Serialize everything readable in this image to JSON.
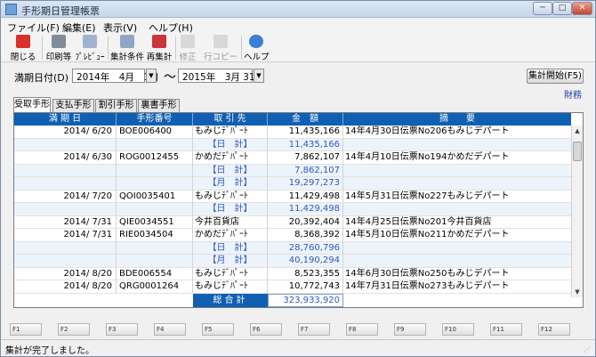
{
  "window": {
    "title": "手形期日管理帳票",
    "minimize": "─",
    "maximize": "□",
    "close": "✕"
  },
  "menu": [
    "ファイル(F)",
    "編集(E)",
    "表示(V)",
    "ヘルプ(H)"
  ],
  "toolbar": {
    "close": "閉じる",
    "print": "印刷等",
    "preview": "ﾌﾟﾚﾋﾞｭｰ",
    "agg_condition": "集計条件",
    "reaggregate": "再集計",
    "modify": "修正",
    "row_copy": "行コピー",
    "help": "ヘルプ"
  },
  "date_range": {
    "label": "満期日付(D)",
    "from": "2014年　4月　1日",
    "tilde": "～",
    "to": "2015年　3月 31日"
  },
  "agg_start_button": "集計開始(F5)",
  "zaimu_link": "財務",
  "tabs": [
    "受取手形",
    "支払手形",
    "割引手形",
    "裏書手形"
  ],
  "table": {
    "headers": [
      "満 期 日",
      "手形番号",
      "取 引 先",
      "金　額",
      "摘　　要"
    ],
    "rows": [
      {
        "date": "2014/ 6/20",
        "num": "BOE006400",
        "name": "もみじﾃﾞﾊﾟｰﾄ",
        "amount": "11,435,166",
        "desc": "14年4月30日伝票No206もみじデパート",
        "type": "data"
      },
      {
        "label": "【日　計】",
        "amount": "11,435,166",
        "type": "sub"
      },
      {
        "date": "2014/ 6/30",
        "num": "ROG0012455",
        "name": "かめだﾃﾞﾊﾟｰﾄ",
        "amount": "7,862,107",
        "desc": "14年4月10日伝票No194かめだデパート",
        "type": "data"
      },
      {
        "label": "【日　計】",
        "amount": "7,862,107",
        "type": "sub"
      },
      {
        "label": "【月　計】",
        "amount": "19,297,273",
        "type": "sub"
      },
      {
        "date": "2014/ 7/20",
        "num": "QOI0035401",
        "name": "もみじﾃﾞﾊﾟｰﾄ",
        "amount": "11,429,498",
        "desc": "14年5月31日伝票No227もみじデパート",
        "type": "data"
      },
      {
        "label": "【日　計】",
        "amount": "11,429,498",
        "type": "sub"
      },
      {
        "date": "2014/ 7/31",
        "num": "QIE0034551",
        "name": "今井百貨店",
        "amount": "20,392,404",
        "desc": "14年4月25日伝票No201今井百貨店",
        "type": "data"
      },
      {
        "date": "2014/ 7/31",
        "num": "RIE0034504",
        "name": "かめだﾃﾞﾊﾟｰﾄ",
        "amount": "8,368,392",
        "desc": "14年5月10日伝票No211かめだデパート",
        "type": "data"
      },
      {
        "label": "【日　計】",
        "amount": "28,760,796",
        "type": "sub"
      },
      {
        "label": "【月　計】",
        "amount": "40,190,294",
        "type": "sub"
      },
      {
        "date": "2014/ 8/20",
        "num": "BDE006554",
        "name": "もみじﾃﾞﾊﾟｰﾄ",
        "amount": "8,523,355",
        "desc": "14年6月30日伝票No250もみじデパート",
        "type": "data"
      },
      {
        "date": "2014/ 8/20",
        "num": "QRG0001264",
        "name": "もみじﾃﾞﾊﾟｰﾄ",
        "amount": "10,772,743",
        "desc": "14年7月31日伝票No273もみじデパート",
        "type": "data"
      }
    ],
    "total_label": "総合計",
    "total_amount": "323,933,920"
  },
  "fkeys": [
    "F1",
    "F2",
    "F3",
    "F4",
    "F5",
    "F6",
    "F7",
    "F8",
    "F9",
    "F10",
    "F11",
    "F12"
  ],
  "status": "集計が完了しました。",
  "colors": {
    "header_bg": "#0f5fb3",
    "subtotal_text": "#2d57c6",
    "alt_row": "#edf3fb"
  }
}
